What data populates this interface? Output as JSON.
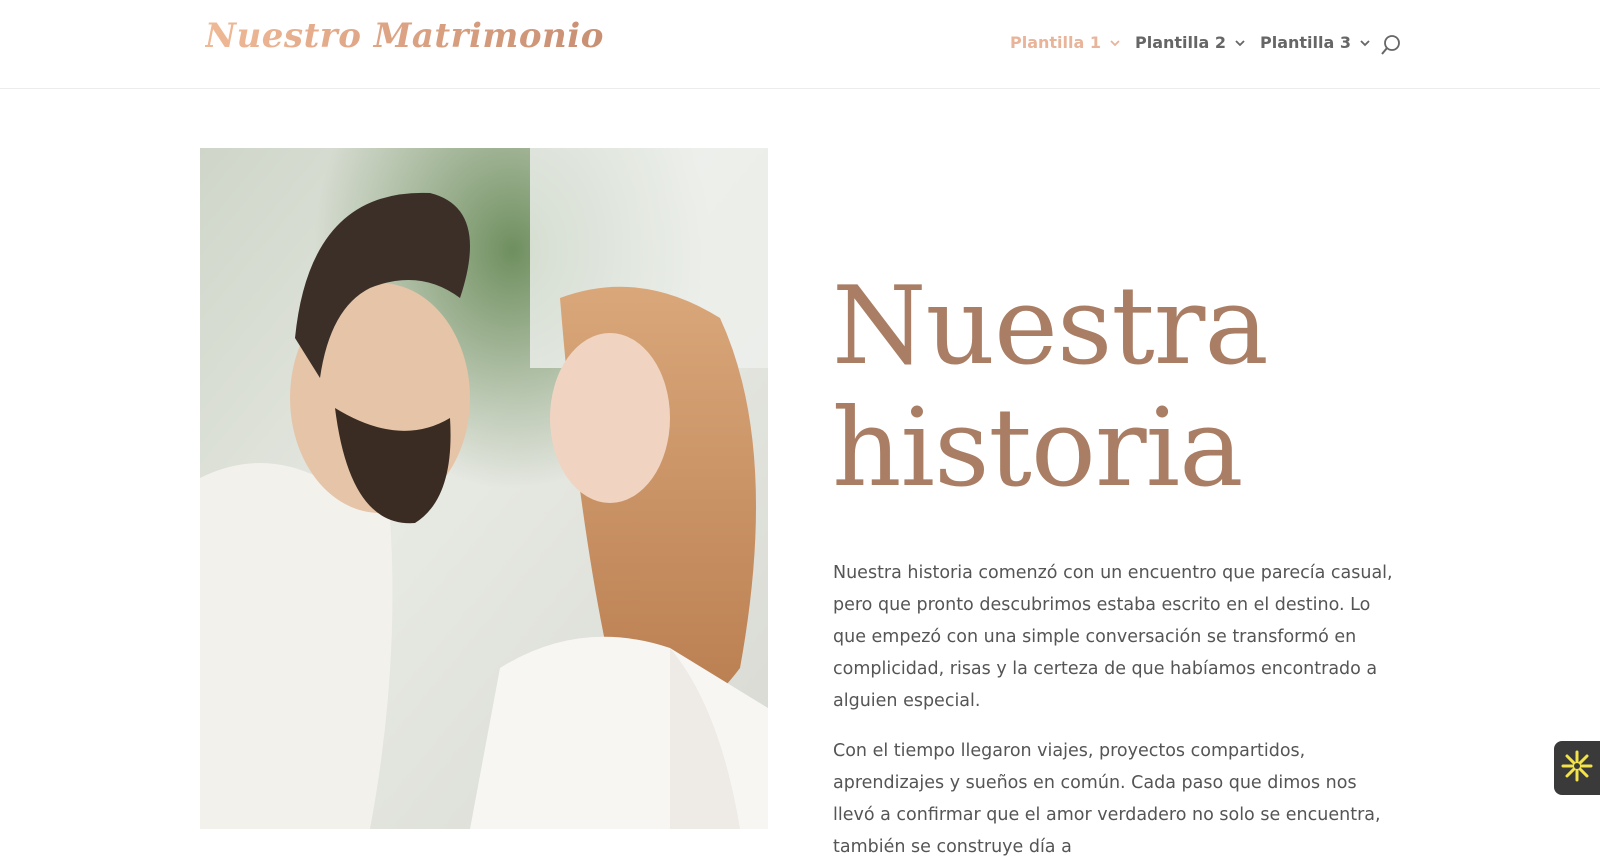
{
  "site": {
    "logo_text": "Nuestro Matrimonio"
  },
  "nav": {
    "items": [
      {
        "label": "Plantilla 1",
        "active": true
      },
      {
        "label": "Plantilla 2",
        "active": false
      },
      {
        "label": "Plantilla 3",
        "active": false
      }
    ],
    "search_icon": "search-icon"
  },
  "hero": {
    "heading_line1": "Nuestra",
    "heading_line2": "historia",
    "paragraph_1": "Nuestra historia comenzó con un encuentro que parecía casual, pero que pronto descubrimos estaba escrito en el destino. Lo que empezó con una simple conversación se transformó en complicidad, risas y la certeza de que habíamos encontrado a alguien especial.",
    "paragraph_2": "Con el tiempo llegaron viajes, proyectos compartidos, aprendizajes y sueños en común. Cada paso que dimos nos llevó a confirmar que el amor verdadero no solo se encuentra, también se construye día a"
  },
  "widget": {
    "icon": "asterisk-flower-icon"
  },
  "colors": {
    "accent": "#a97e64",
    "nav_active": "#e8b49a",
    "body_text": "#555555",
    "widget_bg": "#3a3a3a",
    "widget_icon": "#f2e34a"
  }
}
